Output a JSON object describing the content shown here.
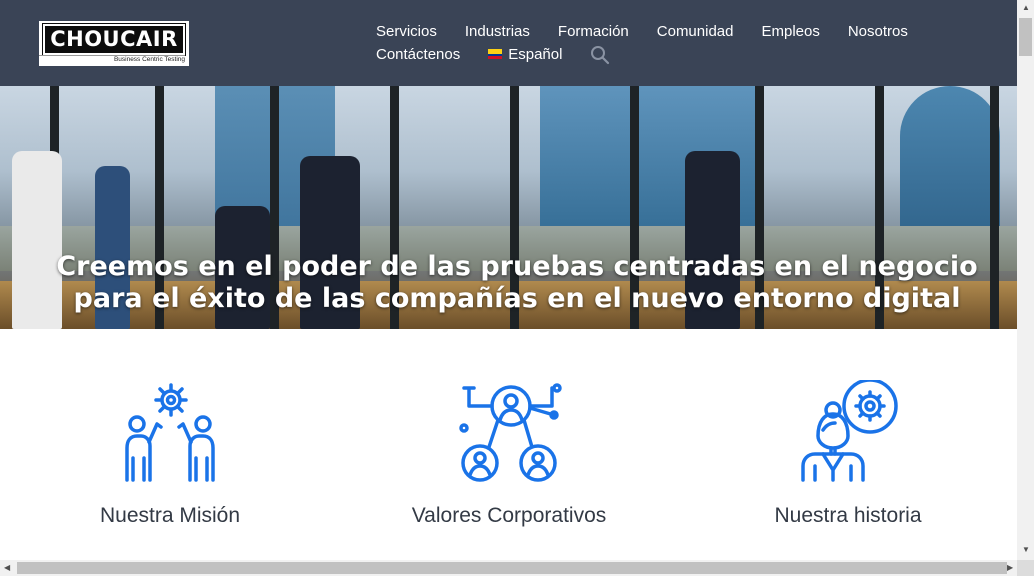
{
  "logo": {
    "name": "CHOUCAIR",
    "tagline": "Business Centric Testing"
  },
  "nav": {
    "row1": [
      "Servicios",
      "Industrias",
      "Formación",
      "Comunidad",
      "Empleos",
      "Nosotros"
    ],
    "row2": [
      "Contáctenos"
    ],
    "language": "Español",
    "language_flag": "colombia-flag-icon",
    "search_icon": "search-icon"
  },
  "hero": {
    "line1": "Creemos en el poder de las pruebas centradas en el negocio",
    "line2": "para el éxito de las compañías en el nuevo entorno digital"
  },
  "features": [
    {
      "title": "Nuestra Misión",
      "icon": "teamwork-gear-icon"
    },
    {
      "title": "Valores Corporativos",
      "icon": "network-people-icon"
    },
    {
      "title": "Nuestra historia",
      "icon": "person-gear-icon"
    }
  ],
  "colors": {
    "header_bg": "#3a4456",
    "icon_blue": "#1a73e8",
    "title_text": "#333a45"
  }
}
